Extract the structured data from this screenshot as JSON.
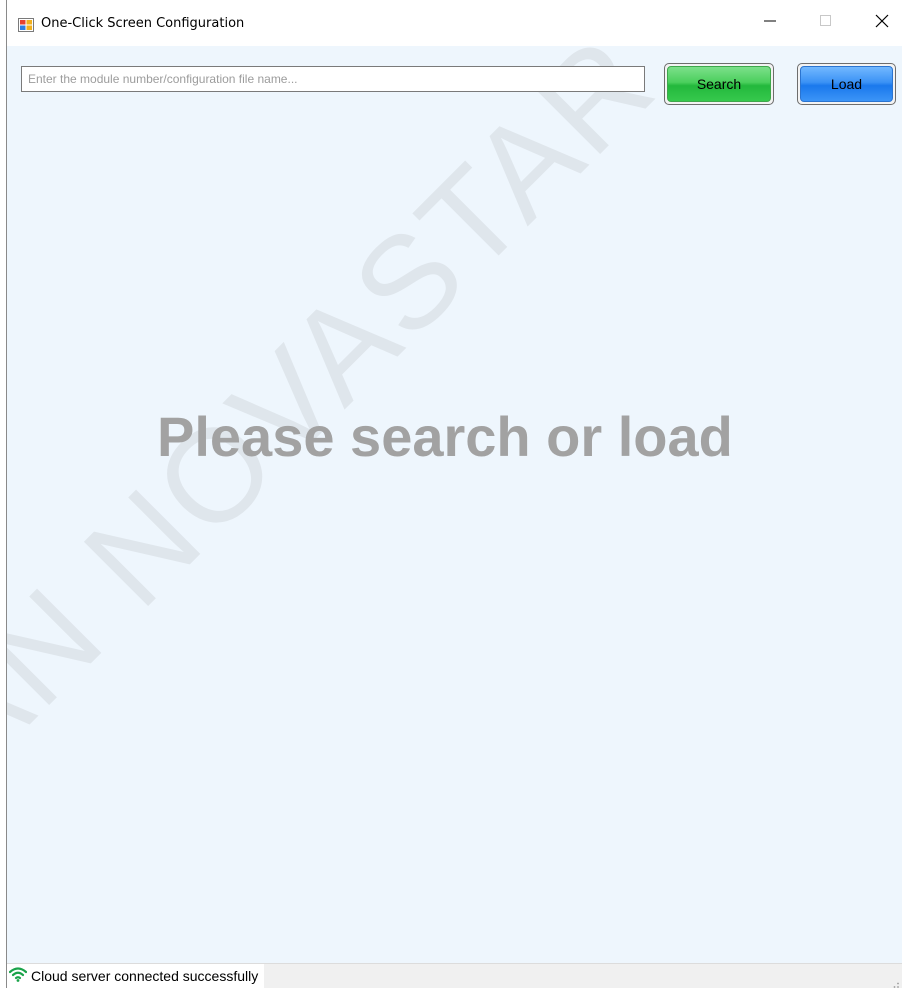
{
  "window": {
    "title": "One-Click Screen Configuration",
    "app_icon": "app-icon",
    "controls": {
      "minimize": "minimize-icon",
      "maximize": "maximize-icon",
      "close": "close-icon"
    }
  },
  "toolbar": {
    "search_placeholder": "Enter the module number/configuration file name...",
    "search_value": "",
    "search_label": "Search",
    "load_label": "Load"
  },
  "main": {
    "hint": "Please search or load",
    "watermark": "XIAN NOVASTAR TECH CO"
  },
  "status": {
    "icon": "wifi-icon",
    "text": "Cloud server connected successfully"
  },
  "colors": {
    "background": "#eef6fd",
    "search_button": "#36c94d",
    "load_button": "#1a78ec",
    "hint_text": "#a2a2a2",
    "status_icon": "#1aa34a"
  }
}
